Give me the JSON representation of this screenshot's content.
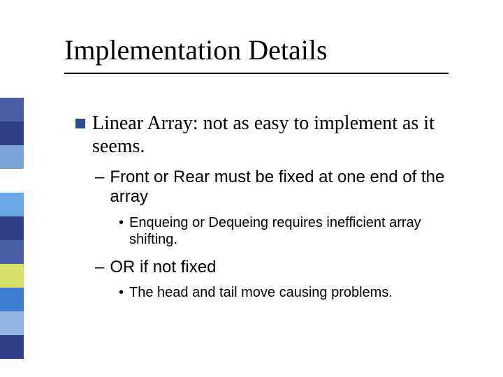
{
  "slide": {
    "title": "Implementation Details",
    "bullets": {
      "l1_0": "Linear Array:  not as easy to implement as it seems.",
      "l2_0": "Front or Rear must be fixed at one end of the array",
      "l3_0": "Enqueing or Dequeing requires inefficient array shifting.",
      "l2_1": "OR if not fixed",
      "l3_1": "The head and tail move causing problems."
    }
  },
  "deco_colors": [
    "#4a5da8",
    "#2f3e87",
    "#7aa5d6",
    "#ffffff",
    "#6aa7e6",
    "#2f3e87",
    "#4a5da8",
    "#d7e06a",
    "#3d7ed1",
    "#8fb6e0",
    "#2f3e87"
  ]
}
